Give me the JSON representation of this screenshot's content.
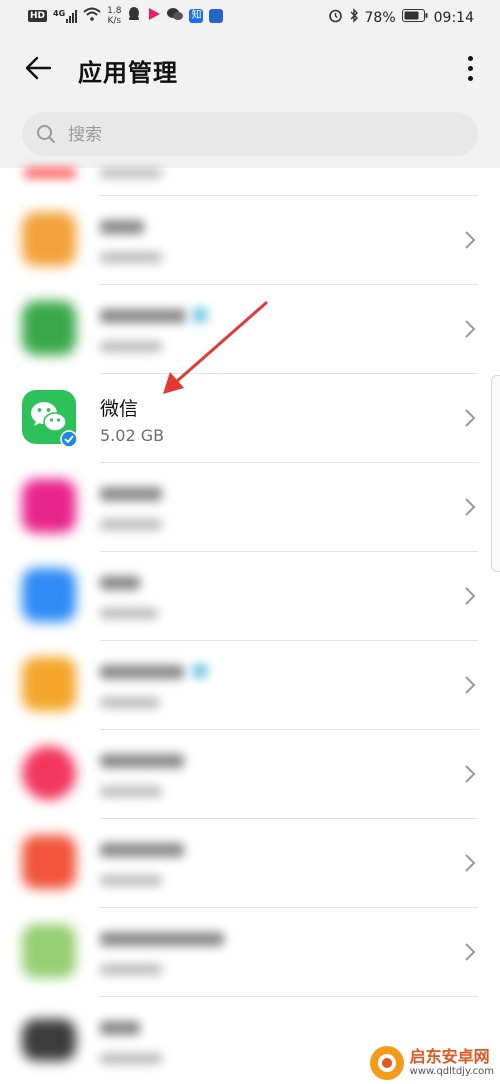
{
  "status_bar": {
    "network_badge": "HD",
    "signal_label": "4G",
    "speed_value": "1.8",
    "speed_unit": "K/s",
    "app_badge": "知",
    "battery": "78%",
    "time": "09:14"
  },
  "header": {
    "title": "应用管理"
  },
  "search": {
    "placeholder": "搜索"
  },
  "apps": [
    {
      "name": "微信",
      "size": "5.02 GB",
      "icon_color": "#2dc15a",
      "highlighted": true
    }
  ],
  "blurred_icon_colors": [
    "#ff5a5a",
    "#f2a23a",
    "#3aa84a",
    "#2dc15a",
    "#e8258c",
    "#2f8cf5",
    "#f4a62a",
    "#f2375f",
    "#f2553b",
    "#96cf74",
    "#3c3c3c"
  ],
  "watermark": {
    "text": "启东安卓网",
    "url": "www.qdltdjy.com"
  },
  "colors": {
    "background": "#ffffff",
    "header": "#f2f2f2",
    "arrow": "#e53935",
    "wechat_green": "#2dc15a",
    "verify_blue": "#1e88e5"
  }
}
